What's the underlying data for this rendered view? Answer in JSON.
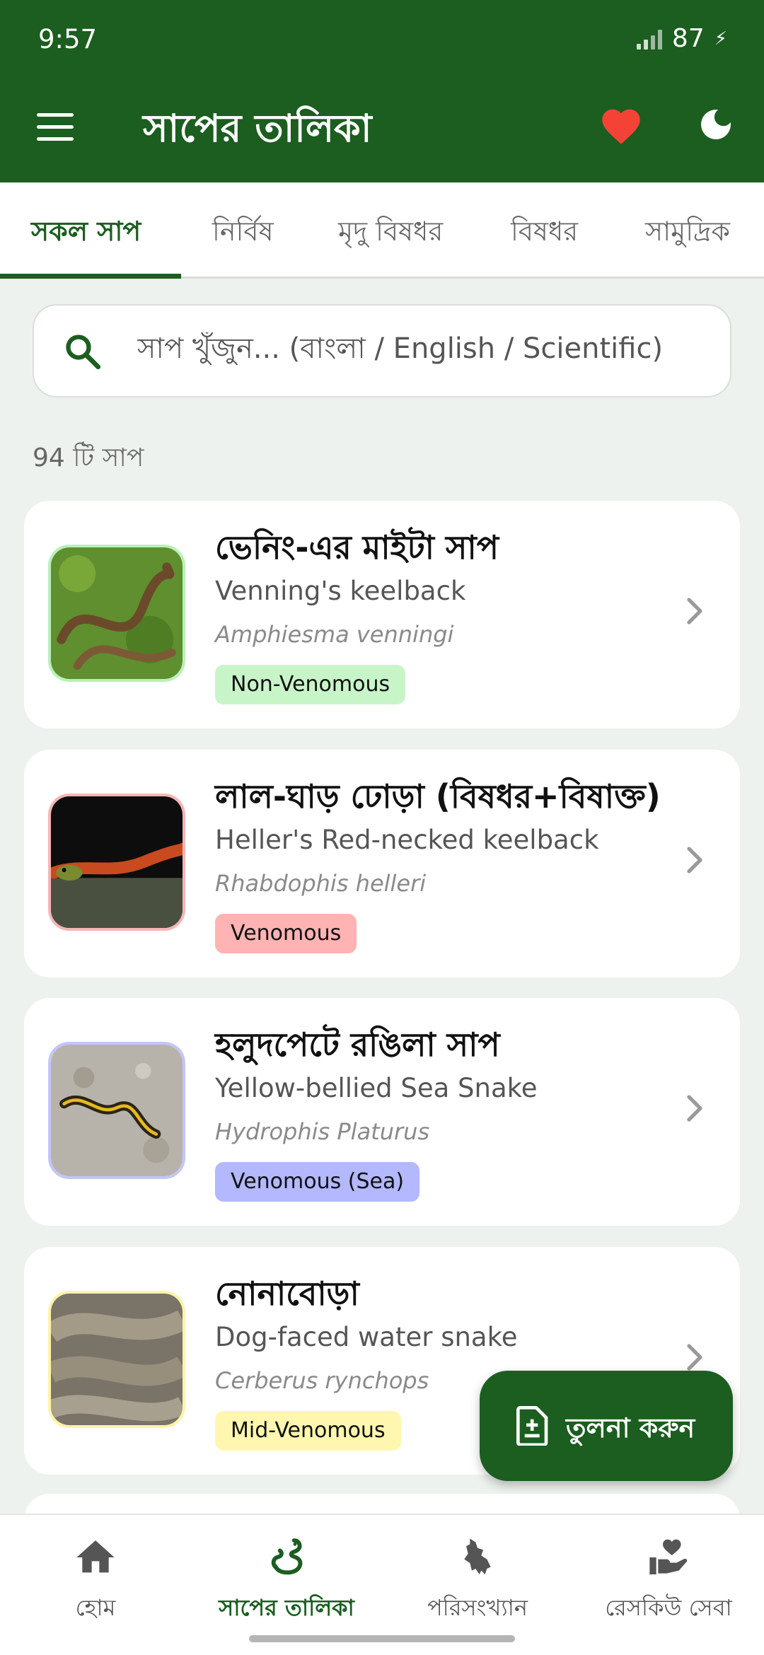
{
  "status_bar": {
    "time": "9:57",
    "battery": "87"
  },
  "app_bar": {
    "title": "সাপের তালিকা",
    "menu_icon": "menu-icon",
    "favorite_icon": "heart-icon",
    "theme_icon": "moon-icon"
  },
  "tabs": [
    {
      "label": "সকল সাপ",
      "active": true
    },
    {
      "label": "নির্বিষ"
    },
    {
      "label": "মৃদু বিষধর"
    },
    {
      "label": "বিষধর"
    },
    {
      "label": "সামুদ্রিক"
    }
  ],
  "search": {
    "placeholder": "সাপ খুঁজুন... (বাংলা / English / Scientific)"
  },
  "count_text": "94 টি সাপ",
  "snakes": [
    {
      "name_bn": "ভেনিং-এর মাইটা সাপ",
      "name_en": "Venning's keelback",
      "scientific": "Amphiesma venningi",
      "badge": "Non-Venomous",
      "badge_color": "#c8f5c8",
      "border_color": "#b9f0b9"
    },
    {
      "name_bn": "লাল-ঘাড় ঢোড়া (বিষধর+বিষাক্ত)",
      "name_en": "Heller's Red-necked keelback",
      "scientific": "Rhabdophis helleri",
      "badge": "Venomous",
      "badge_color": "#ffb3b3",
      "border_color": "#f7b5b5"
    },
    {
      "name_bn": "হলুদপেটে রঙিলা সাপ",
      "name_en": "Yellow-bellied Sea Snake",
      "scientific": "Hydrophis Platurus",
      "badge": "Venomous (Sea)",
      "badge_color": "#b3b8ff",
      "border_color": "#c2c6f7"
    },
    {
      "name_bn": "নোনাবোড়া",
      "name_en": "Dog-faced water snake",
      "scientific": "Cerberus rynchops",
      "badge": "Mid-Venomous",
      "badge_color": "#fff7b0",
      "border_color": "#fff3a8"
    }
  ],
  "fab": {
    "label": "তুলনা করুন",
    "icon": "compare-list-icon"
  },
  "bottom_nav": [
    {
      "label": "হোম",
      "icon": "home-icon"
    },
    {
      "label": "সাপের তালিকা",
      "icon": "snake-icon",
      "active": true
    },
    {
      "label": "পরিসংখ্যান",
      "icon": "bangladesh-map-icon"
    },
    {
      "label": "রেসকিউ সেবা",
      "icon": "rescue-hand-heart-icon"
    }
  ],
  "colors": {
    "primary": "#1b5e20",
    "accent_heart": "#f44336"
  }
}
